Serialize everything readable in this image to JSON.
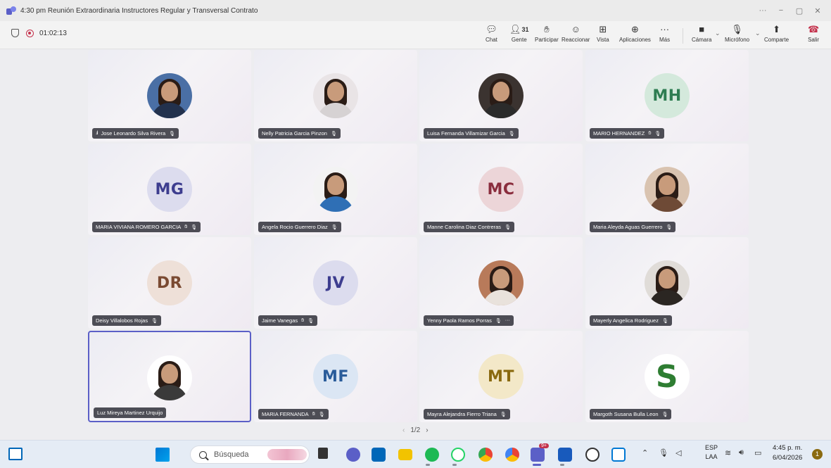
{
  "window": {
    "title": "4:30 pm Reunión Extraordinaria Instructores Regular y Transversal Contrato",
    "controls": [
      "···",
      "−",
      "▢",
      "✕"
    ]
  },
  "meeting": {
    "timer": "01:02:13",
    "people_count": "31",
    "toolbar": {
      "chat": "Chat",
      "people": "Gente",
      "raise": "Participar",
      "react": "Reaccionar",
      "view": "Vista",
      "apps": "Aplicaciones",
      "more": "Más",
      "camera": "Cámara",
      "mic": "Micrófono",
      "share": "Comparte",
      "leave": "Salir"
    }
  },
  "participants": [
    {
      "name": "Jose Leonardo Silva Rivera",
      "avatar_type": "photo",
      "initials": "",
      "bg": "#4a6fa5",
      "body": "#22314d",
      "signal": true
    },
    {
      "name": "Nelly Patricia Garcia Pinzon",
      "avatar_type": "photo",
      "initials": "",
      "bg": "#e9e4e6",
      "body": "#d6d2d3"
    },
    {
      "name": "Luisa Fernanda Villamizar Garcia",
      "avatar_type": "photo",
      "initials": "",
      "bg": "#3b3330",
      "body": "#2b2b2b"
    },
    {
      "name": "MARIO HERNANDEZ",
      "avatar_type": "initials",
      "initials": "MH",
      "bg": "#d4e9dc",
      "fg": "#2e7d52",
      "hand": true
    },
    {
      "name": "MARIA VIVIANA ROMERO GARCIA",
      "avatar_type": "initials",
      "initials": "MG",
      "bg": "#dcdcee",
      "fg": "#3d3d8f",
      "hand": true
    },
    {
      "name": "Angela Rocio Guerrero Diaz",
      "avatar_type": "photo",
      "initials": "",
      "bg": "#f3f3f3",
      "body": "#2f6fb5"
    },
    {
      "name": "Manne Carolina Diaz Contreras",
      "avatar_type": "initials",
      "initials": "MC",
      "bg": "#ecd5d8",
      "fg": "#8a2d3d"
    },
    {
      "name": "Maria Aleyda Aguas Guerrero",
      "avatar_type": "photo",
      "initials": "",
      "bg": "#d9c3b0",
      "body": "#6e4a36"
    },
    {
      "name": "Deisy Villalobos Rojas",
      "avatar_type": "initials",
      "initials": "DR",
      "bg": "#eee0d8",
      "fg": "#7a4a32"
    },
    {
      "name": "Jaime Vanegas",
      "avatar_type": "initials",
      "initials": "JV",
      "bg": "#dcdcee",
      "fg": "#3d3d8f",
      "hand": true
    },
    {
      "name": "Yenny Paola Ramos Porras",
      "avatar_type": "photo",
      "initials": "",
      "bg": "#b87a5a",
      "body": "#e9e2dc",
      "more": true
    },
    {
      "name": "Mayerly Angelica Rodriguez",
      "avatar_type": "photo",
      "initials": "",
      "bg": "#e0dcd8",
      "body": "#2b2622"
    },
    {
      "name": "Luz Mireya Martinez Urquijo",
      "avatar_type": "photo",
      "initials": "",
      "bg": "#ffffff",
      "body": "#3a3a3a",
      "active": true,
      "nomic": true
    },
    {
      "name": "MARIA FERNANDA",
      "avatar_type": "initials",
      "initials": "MF",
      "bg": "#dbe6f4",
      "fg": "#2a5c9a",
      "hand": true
    },
    {
      "name": "Mayra Alejandra Fierro Triana",
      "avatar_type": "initials",
      "initials": "MT",
      "bg": "#f3e8c8",
      "fg": "#8a6a10"
    },
    {
      "name": "Margoth Susana Bulla Leon",
      "avatar_type": "logo",
      "initials": "S",
      "bg": "#ffffff",
      "fg": "#2e7d32"
    }
  ],
  "pager": {
    "text": "1/2",
    "prev": "‹",
    "next": "›"
  },
  "taskbar": {
    "search_placeholder": "Búsqueda",
    "lang_top": "ESP",
    "lang_bottom": "LAA",
    "time": "4:45 p. m.",
    "date": "6/04/2026",
    "notifications": "1",
    "badge": "9+"
  },
  "icons": {
    "colors": {
      "teams": "#5b5fc7",
      "windows": "#0078d4",
      "spotify": "#1db954",
      "whatsapp": "#25d366",
      "word": "#185abc",
      "explorer": "#f2c300",
      "store": "#0067b8"
    }
  }
}
